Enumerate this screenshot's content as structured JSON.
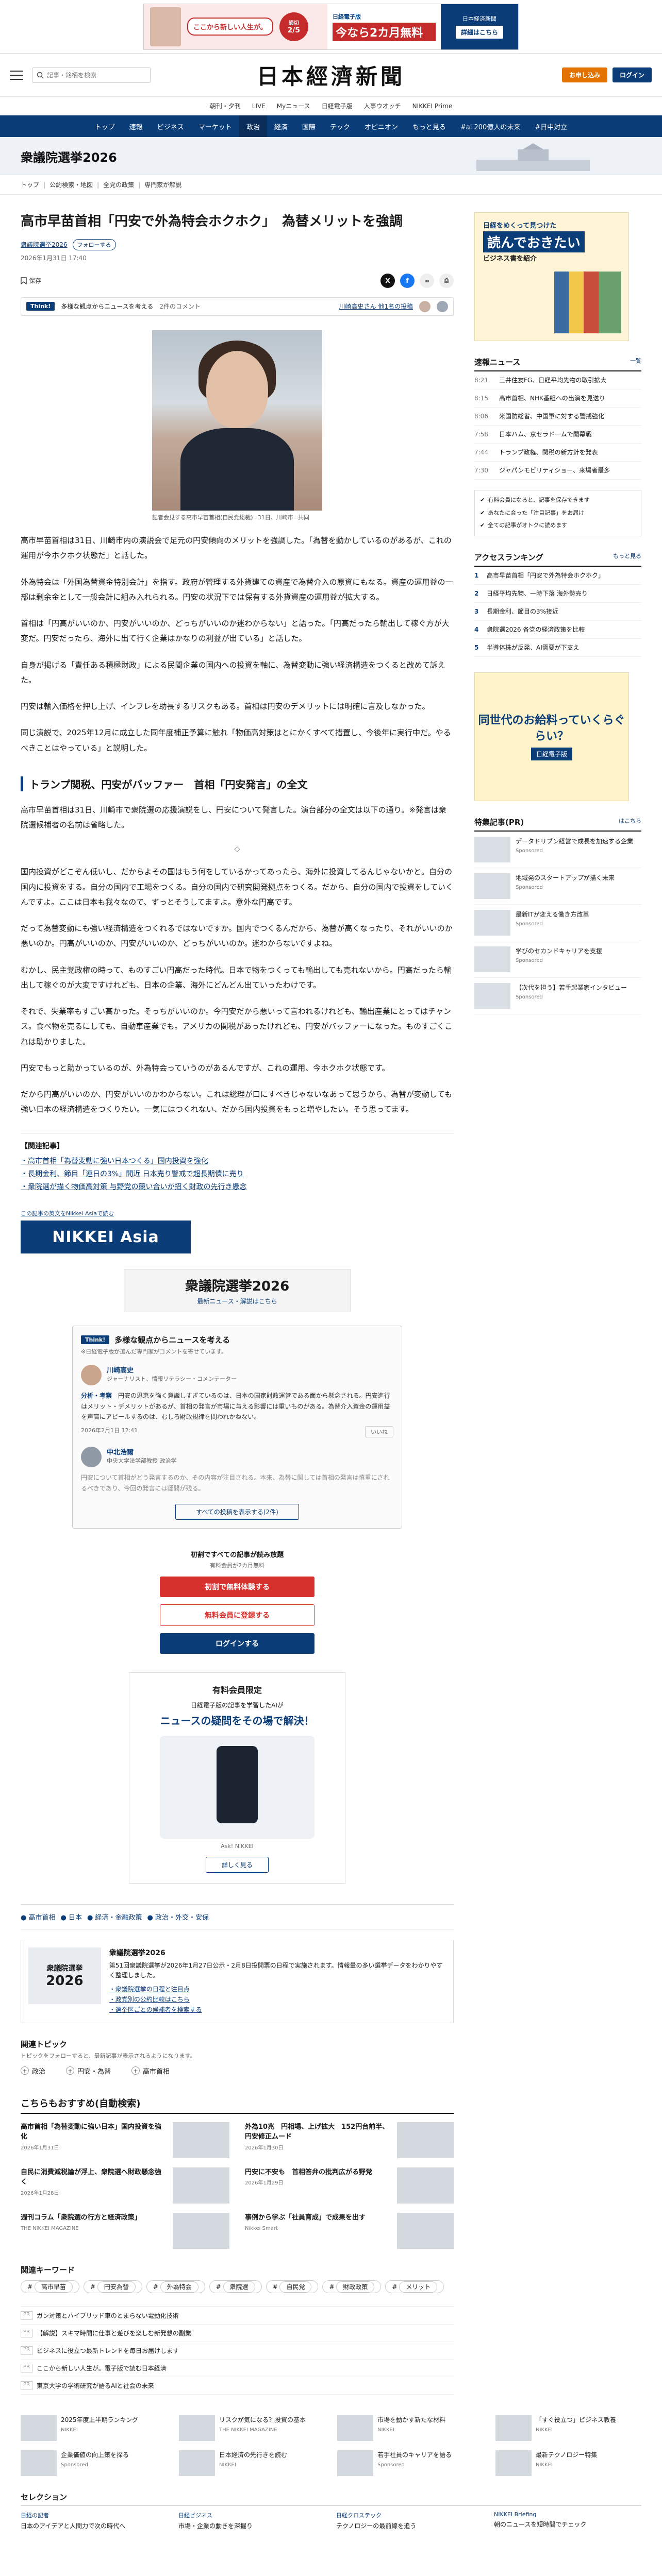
{
  "ad_top": {
    "bubble": "ここから新しい人生が。",
    "date": "2/5",
    "date_label": "締切",
    "brand": "日経電子版",
    "headline": "今なら2カ月無料",
    "cta": "詳細はこちら",
    "right_brand": "日本経済新聞"
  },
  "header": {
    "search_placeholder": "記事・銘柄を検索",
    "logo": "日本經濟新聞",
    "trial_label": "お申し込み",
    "login_label": "ログイン"
  },
  "subnav": [
    "朝刊・夕刊",
    "LIVE",
    "Myニュース",
    "日経電子版",
    "人事ウオッチ",
    "NIKKEI Prime"
  ],
  "mainnav": [
    {
      "label": "トップ",
      "active": false
    },
    {
      "label": "速報",
      "active": false
    },
    {
      "label": "ビジネス",
      "active": false
    },
    {
      "label": "マーケット",
      "active": false
    },
    {
      "label": "政治",
      "active": true
    },
    {
      "label": "経済",
      "active": false
    },
    {
      "label": "国際",
      "active": false
    },
    {
      "label": "テック",
      "active": false
    },
    {
      "label": "オピニオン",
      "active": false
    },
    {
      "label": "もっと見る",
      "active": false
    },
    {
      "label": "#ai 200億人の未来",
      "active": false
    },
    {
      "label": "#日中対立",
      "active": false
    }
  ],
  "section": {
    "title": "衆議院選挙2026"
  },
  "breadcrumb": [
    "トップ",
    "公約検索・地図",
    "全党の政策",
    "専門家が解説"
  ],
  "article": {
    "title": "高市早苗首相「円安で外為特会ホクホク」　為替メリットを強調",
    "tag": "衆議院選挙2026",
    "follow": "フォローする",
    "date": "2026年1月31日 17:40",
    "save_label": "保存",
    "think_badge": "Think!",
    "think_text": "多様な観点からニュースを考える",
    "think_count": "2件のコメント",
    "think_link": "川崎高史さん 他1名の投稿",
    "image_caption": "記者会見する高市早苗首相(自民党総裁)=31日、川崎市=共同",
    "p1": "高市早苗首相は31日、川崎市内の演説会で足元の円安傾向のメリットを強調した。「為替を動かしているのがあるが、これの運用が今ホクホク状態だ」と話した。",
    "p2": "外為特会は「外国為替資金特別会計」を指す。政府が管理する外貨建ての資産で為替介入の原資にもなる。資産の運用益の一部は剰余金として一般会計に組み入れられる。円安の状況下では保有する外貨資産の運用益が拡大する。",
    "p3": "首相は「円高がいいのか、円安がいいのか、どっちがいいのか迷わからない」と語った。「円高だったら輸出して稼ぐ方が大変だ。円安だったら、海外に出て行く企業はかなりの利益が出ている」と話した。",
    "p4": "自身が掲げる「責任ある積極財政」による民間企業の国内への投資を軸に、為替変動に強い経済構造をつくると改めて訴えた。",
    "p5": "円安は輸入価格を押し上げ、インフレを助長するリスクもある。首相は円安のデメリットには明確に言及しなかった。",
    "p6": "同じ演説で、2025年12月に成立した同年度補正予算に触れ「物価高対策はとにかくすべて措置し、今後年に実行中だ。やるべきことはやっている」と説明した。",
    "sub_heading": "トランプ関税、円安がバッファー　首相「円安発言」の全文",
    "q1": "高市早苗首相は31日、川崎市で衆院選の応援演説をし、円安について発言した。演台部分の全文は以下の通り。※発言は衆院選候補者の名前は省略した。",
    "q2": "国内投資がどこぞん低いし、だからよその国はもう何をしているかってあったら、海外に投資してるんじゃないかと。自分の国内に投資をする。自分の国内で工場をつくる。自分の国内で研究開発拠点をつくる。だから、自分の国内で投資をしていくんですよ。ここは日本も我々なので、ずっとそうしてますよ。意外な円高です。",
    "q3": "だって為替変動にも強い経済構造をつくれるではないですか。国内でつくるんだから、為替が高くなったり、それがいいのか悪いのか。円高がいいのか、円安がいいのか、どっちがいいのか。迷わからないですよね。",
    "q4": "むかし、民主党政権の時って、ものすごい円高だった時代。日本で物をつくっても輸出しても売れないから。円高だったら輸出して稼ぐのが大変ですけれども、日本の企業、海外にどんどん出ていったわけです。",
    "q5": "それで、失業率もすごい高かった。そっちがいいのか。今円安だから悪いって言われるけれども、輸出産業にとってはチャンス。食べ物を売るにしても、自動車産業でも。アメリカの関税があったけれども、円安がバッファーになった。ものすごくこれは助かりました。",
    "q6": "円安でもっと助かっているのが、外為特会っていうのがあるんですが、これの運用、今ホクホク状態です。",
    "q7": "だから円高がいいのか、円安がいいのかわからない。これは総理が口にすべきじゃないなあって思うから、為替が変動しても強い日本の経済構造をつくりたい。一気にはつくれない、だから国内投資をもっと増やしたい。そう思ってます。",
    "related_label": "【関連記事】",
    "related": [
      "高市首相「為替変動に強い日本つくる」国内投資を強化",
      "長期金利、節目「連日の3%」間近 日本売り警戒で超長期債に売り",
      "衆院選が描く物価高対策 与野党の競い合いが招く財政の先行き懸念"
    ],
    "na_caption": "この記事の英文をNikkei Asiaで読む",
    "na_logo": "NIKKEI Asia"
  },
  "senkyo_banner": {
    "title": "衆議院選挙2026",
    "sub": "最新ニュース・解説はこちら"
  },
  "think_box": {
    "title": "多様な観点からニュースを考える",
    "sub": "※日経電子版が選んだ専門家がコメントを寄せています。",
    "expert1": {
      "name": "川崎高史",
      "role": "ジャーナリスト、情報リテラシー・コメンテーター",
      "label": "分析・考察",
      "text": "円安の恩恵を強く意識しすぎているのは、日本の国家財政運営である面から懸念される。円安進行はメリット・デメリットがあるが、首相の発言が市場に与える影響には重いものがある。為替介入資金の運用益を声高にアピールするのは、むしろ財政規律を問われかねない。",
      "date": "2026年2月1日 12:41",
      "like": "いいね"
    },
    "expert2": {
      "name": "中北浩爾",
      "role": "中央大学法学部教授 政治学",
      "text": "円安について首相がどう発言するのか、その内容が注目される。本来、為替に関しては首相の発言は慎重にされるべきであり、今回の発言には疑問が残る。"
    },
    "more": "すべての投稿を表示する(2件)"
  },
  "paywall": {
    "t1": "初割ですべての記事が読み放題",
    "t2": "有料会員が2カ月無料",
    "btn1": "初割で無料体験する",
    "btn2": "無料会員に登録する",
    "btn3": "ログインする"
  },
  "promo": {
    "label": "有料会員限定",
    "t1": "日経電子版の記事を学習したAIが",
    "t2": "ニュースの疑問をその場で解決！",
    "cap": "Ask! NIKKEI",
    "btn": "詳しく見る"
  },
  "tag_strip": [
    "高市首相",
    "日本",
    "経済・金融政策",
    "政治・外交・安保"
  ],
  "topic_card": {
    "thumb_title": "衆議院選挙",
    "thumb_year": "2026",
    "title": "衆議院選挙2026",
    "desc": "第51回衆議院選挙が2026年1月27日公示・2月8日投開票の日程で実施されます。情報量の多い選挙データをわかりやすく整理しました。",
    "links": [
      "衆議院選挙の日程と注目点",
      "政党別の公約比較はこちら",
      "選挙区ごとの候補者を検索する"
    ]
  },
  "rel_topic": {
    "title": "関連トピック",
    "small": "トピックをフォローすると、最新記事が表示されるようになります。",
    "items": [
      "政治",
      "円安・為替",
      "高市首相"
    ]
  },
  "reco": {
    "title": "こちらもおすすめ(自動検索)",
    "items": [
      {
        "title": "高市首相「為替変動に強い日本」国内投資を強化",
        "src": "2026年1月31日"
      },
      {
        "title": "外為10兆　円相場、上げ拡大　152円台前半、円安修正ムード",
        "src": "2026年1月30日"
      },
      {
        "title": "自民に消費減税論が浮上、衆院選へ財政懸念強く",
        "src": "2026年1月28日"
      },
      {
        "title": "円安に不安も　首相答弁の批判広がる野党",
        "src": "2026年1月29日"
      },
      {
        "title": "週刊コラム「衆院選の行方と経済政策」",
        "src": "THE NIKKEI MAGAZINE"
      },
      {
        "title": "事例から学ぶ「社員育成」で成果を出す",
        "src": "Nikkei Smart"
      }
    ]
  },
  "keywords": {
    "title": "関連キーワード",
    "items": [
      "高市早苗",
      "円安為替",
      "外為特会",
      "衆院選",
      "自民党",
      "財政政策",
      "メリット"
    ]
  },
  "pr_list": [
    "ガン対策とハイブリッド車のとまらない電動化技術",
    "【解説】スキマ時間に仕事と遊びを楽しむ新発想の副業",
    "ビジネスに役立つ最新トレンドを毎日お届けします",
    "ここから新しい人生が。電子版で読む日本経済",
    "東京大学の学術研究が語るAIと社会の未来"
  ],
  "side_ad1": {
    "t1": "日経をめくって見つけた",
    "t2": "読んでおきたい",
    "t3": "ビジネス書を紹介"
  },
  "news": {
    "title": "速報ニュース",
    "more": "一覧",
    "items": [
      {
        "time": "8:21",
        "text": "三井住友FG、日経平均先物の取引拡大"
      },
      {
        "time": "8:15",
        "text": "高市首相、NHK番組への出演を見送り"
      },
      {
        "time": "8:06",
        "text": "米国防総省、中国軍に対する警戒強化"
      },
      {
        "time": "7:58",
        "text": "日本ハム、京セラドームで開幕戦"
      },
      {
        "time": "7:44",
        "text": "トランプ政権、関税の新方針を発表"
      },
      {
        "time": "7:30",
        "text": "ジャパンモビリティショー、来場者最多"
      }
    ]
  },
  "side_notice": {
    "r1": "有料会員になると、記事を保存できます",
    "r2": "あなたに合った「注目記事」をお届け",
    "r3": "全ての記事がオトクに読めます"
  },
  "ranking": {
    "title": "アクセスランキング",
    "more": "もっと見る",
    "items": [
      "高市早苗首相「円安で外為特会ホクホク」",
      "日経平均先物、一時下落 海外勢売り",
      "長期金利、節目の3%接近",
      "衆院選2026 各党の経済政策を比較",
      "半導体株が反発、AI需要が下支え"
    ]
  },
  "side_ad2": {
    "t1": "同世代のお給料っていくらぐらい？",
    "t2": "日経電子版"
  },
  "features": {
    "title": "特集記事(PR)",
    "more": "はこちら",
    "items": [
      {
        "title": "データドリブン経営で成長を加速する企業",
        "src": "Sponsored"
      },
      {
        "title": "地域発のスタートアップが描く未来",
        "src": "Sponsored"
      },
      {
        "title": "最新ITが変える働き方改革",
        "src": "Sponsored"
      },
      {
        "title": "学びのセカンドキャリアを支援",
        "src": "Sponsored"
      },
      {
        "title": "【次代を担う】若手起業家インタビュー",
        "src": "Sponsored"
      }
    ]
  },
  "bottom": [
    {
      "title": "2025年度上半期ランキング",
      "src": "NIKKEI"
    },
    {
      "title": "リスクが気になる？投資の基本",
      "src": "THE NIKKEI MAGAZINE"
    },
    {
      "title": "市場を動かす新たな材料",
      "src": "NIKKEI"
    },
    {
      "title": "「すぐ役立つ」ビジネス教養",
      "src": "NIKKEI"
    },
    {
      "title": "企業価値の向上策を探る",
      "src": "Sponsored"
    },
    {
      "title": "日本経済の先行きを読む",
      "src": "NIKKEI"
    },
    {
      "title": "若手社員のキャリアを語る",
      "src": "Sponsored"
    },
    {
      "title": "最新テクノロジー特集",
      "src": "NIKKEI"
    }
  ],
  "selection": {
    "title": "セレクション",
    "items": [
      {
        "brand": "日経の記者",
        "text": "日本のアイデアと人間力で次の時代へ"
      },
      {
        "brand": "日経ビジネス",
        "text": "市場・企業の動きを深掘り"
      },
      {
        "brand": "日経クロステック",
        "text": "テクノロジーの最前線を追う"
      },
      {
        "brand": "NIKKEI Briefing",
        "text": "朝のニュースを短時間でチェック"
      }
    ]
  }
}
